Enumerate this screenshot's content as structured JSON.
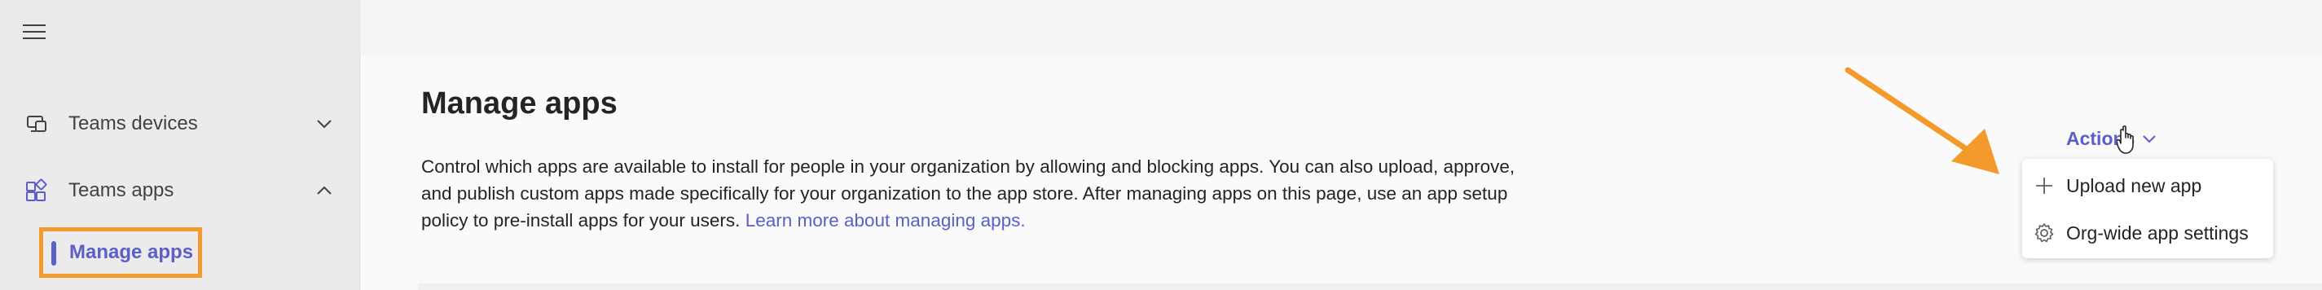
{
  "sidebar": {
    "items": [
      {
        "label": "Teams devices",
        "icon": "devices-icon",
        "expanded": false
      },
      {
        "label": "Teams apps",
        "icon": "apps-icon",
        "expanded": true
      }
    ],
    "subitems": [
      {
        "label": "Manage apps",
        "selected": true
      }
    ]
  },
  "main": {
    "title": "Manage apps",
    "description": "Control which apps are available to install for people in your organization by allowing and blocking apps. You can also upload, approve, and publish custom apps made specifically for your organization to the app store. After managing apps on this page, use an app setup policy to pre-install apps for your users.",
    "learn_more": "Learn more about managing apps."
  },
  "actions": {
    "label": "Actions",
    "menu": [
      {
        "label": "Upload new app",
        "icon": "plus-icon"
      },
      {
        "label": "Org-wide app settings",
        "icon": "gear-icon"
      }
    ]
  },
  "colors": {
    "accent": "#5b5fc7",
    "highlight": "#f39a2b",
    "sidebar_bg": "#ebebeb"
  }
}
